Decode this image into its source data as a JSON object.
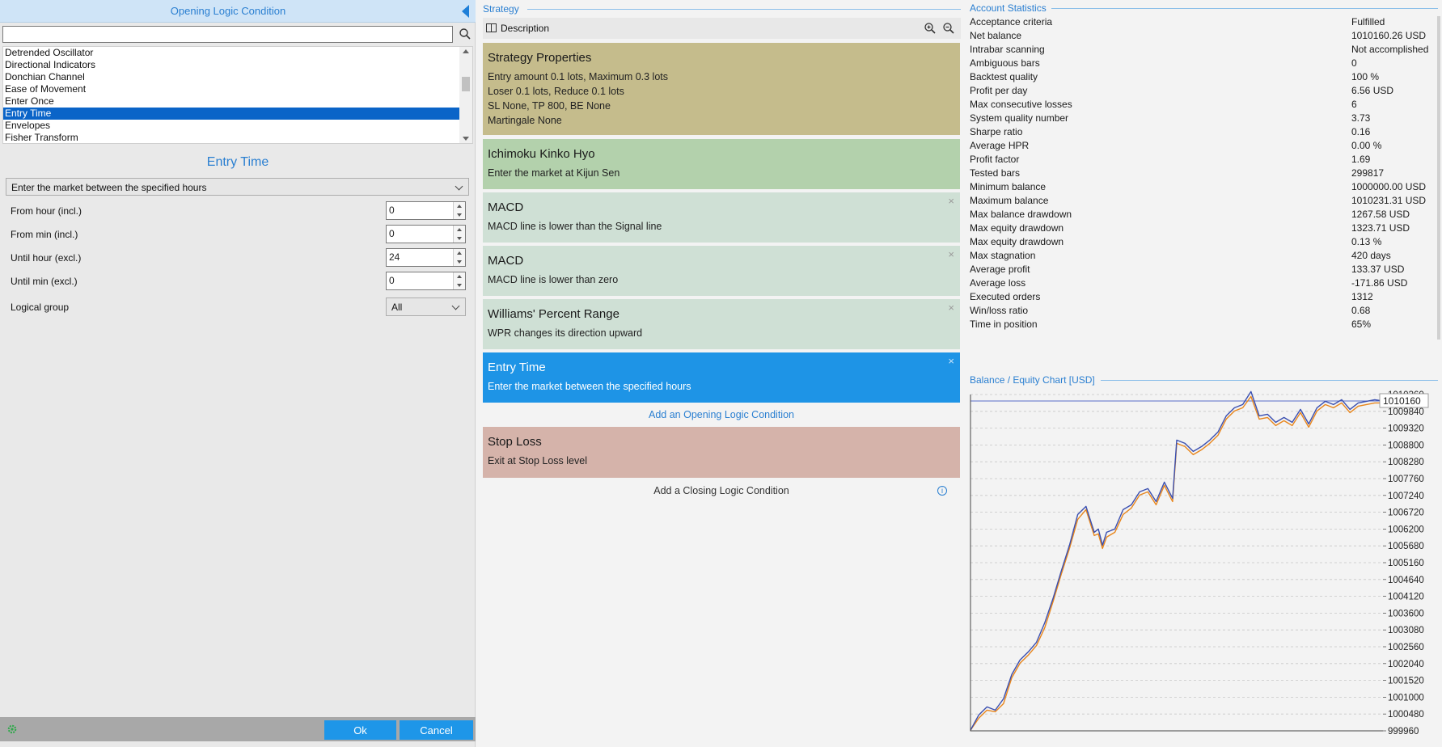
{
  "left_panel": {
    "title": "Opening Logic Condition",
    "search": {
      "value": "",
      "placeholder": ""
    },
    "indicator_list": [
      "Detrended Oscillator",
      "Directional Indicators",
      "Donchian Channel",
      "Ease of Movement",
      "Enter Once",
      "Entry Time",
      "Envelopes",
      "Fisher Transform"
    ],
    "selected_index": 5,
    "indicator_title": "Entry Time",
    "logic_select": "Enter the market between the specified hours",
    "params": [
      {
        "label": "From hour (incl.)",
        "value": "0"
      },
      {
        "label": "From min (incl.)",
        "value": "0"
      },
      {
        "label": "Until hour (excl.)",
        "value": "24"
      },
      {
        "label": "Until min (excl.)",
        "value": "0"
      }
    ],
    "logical_group": {
      "label": "Logical group",
      "value": "All"
    },
    "ok_label": "Ok",
    "cancel_label": "Cancel"
  },
  "strategy": {
    "section_title": "Strategy",
    "description_label": "Description",
    "properties": {
      "name": "Strategy Properties",
      "lines": [
        "Entry amount 0.1 lots, Maximum 0.3 lots",
        "Loser 0.1 lots, Reduce 0.1 lots",
        "SL None,  TP 800,  BE None",
        "Martingale None"
      ]
    },
    "slots": [
      {
        "name": "Ichimoku Kinko Hyo",
        "desc": "Enter the market at Kijun Sen",
        "color": "#b3d1ac"
      },
      {
        "name": "MACD",
        "desc": "MACD line is lower than the Signal line",
        "color": "#cfe0d5"
      },
      {
        "name": "MACD",
        "desc": "MACD line is lower than zero",
        "color": "#cfe0d5"
      },
      {
        "name": "Williams' Percent Range",
        "desc": "WPR changes its direction upward",
        "color": "#cfe0d5"
      },
      {
        "name": "Entry Time",
        "desc": "Enter the market between the specified hours",
        "color": "#1e94e6"
      }
    ],
    "add_opening_label": "Add an Opening Logic Condition",
    "closing_slot": {
      "name": "Stop Loss",
      "desc": "Exit at Stop Loss level",
      "color": "#d5b3aa"
    },
    "add_closing_label": "Add a Closing Logic Condition",
    "close_glyph": "×",
    "info_glyph": "i"
  },
  "account_statistics": {
    "section_title": "Account Statistics",
    "rows": [
      {
        "k": "Acceptance criteria",
        "v": "Fulfilled"
      },
      {
        "k": "Net balance",
        "v": "1010160.26 USD"
      },
      {
        "k": "Intrabar scanning",
        "v": "Not accomplished"
      },
      {
        "k": "Ambiguous bars",
        "v": "0"
      },
      {
        "k": "Backtest quality",
        "v": "100 %"
      },
      {
        "k": "Profit per day",
        "v": "6.56 USD"
      },
      {
        "k": "Max consecutive losses",
        "v": "6"
      },
      {
        "k": "System quality number",
        "v": "3.73"
      },
      {
        "k": "Sharpe ratio",
        "v": "0.16"
      },
      {
        "k": "Average HPR",
        "v": "0.00 %"
      },
      {
        "k": "Profit factor",
        "v": "1.69"
      },
      {
        "k": "Tested bars",
        "v": "299817"
      },
      {
        "k": "Minimum balance",
        "v": "1000000.00 USD"
      },
      {
        "k": "Maximum balance",
        "v": "1010231.31 USD"
      },
      {
        "k": "Max balance drawdown",
        "v": "1267.58 USD"
      },
      {
        "k": "Max equity drawdown",
        "v": "1323.71 USD"
      },
      {
        "k": "Max equity drawdown",
        "v": "0.13 %"
      },
      {
        "k": "Max stagnation",
        "v": "420 days"
      },
      {
        "k": "Average profit",
        "v": "133.37 USD"
      },
      {
        "k": "Average loss",
        "v": "-171.86 USD"
      },
      {
        "k": "Executed orders",
        "v": "1312"
      },
      {
        "k": "Win/loss ratio",
        "v": "0.68"
      },
      {
        "k": "Time in position",
        "v": "65%"
      }
    ]
  },
  "chart_data": {
    "type": "line",
    "title": "Balance / Equity Chart [USD]",
    "xlabel": "",
    "ylabel": "",
    "ylim": [
      999960,
      1010360
    ],
    "yticks": [
      "1010360",
      "1009840",
      "1009320",
      "1008800",
      "1008280",
      "1007760",
      "1007240",
      "1006720",
      "1006200",
      "1005680",
      "1005160",
      "1004640",
      "1004120",
      "1003600",
      "1003080",
      "1002560",
      "1002040",
      "1001520",
      "1001000",
      "1000480",
      "999960"
    ],
    "current_value_label": "1010160",
    "current_value": 1010160,
    "x": [
      0,
      0.02,
      0.04,
      0.06,
      0.08,
      0.1,
      0.12,
      0.14,
      0.16,
      0.18,
      0.2,
      0.22,
      0.24,
      0.26,
      0.28,
      0.3,
      0.31,
      0.32,
      0.33,
      0.35,
      0.37,
      0.39,
      0.41,
      0.43,
      0.45,
      0.47,
      0.49,
      0.5,
      0.52,
      0.54,
      0.56,
      0.58,
      0.6,
      0.62,
      0.64,
      0.66,
      0.68,
      0.7,
      0.72,
      0.74,
      0.76,
      0.78,
      0.8,
      0.82,
      0.84,
      0.86,
      0.88,
      0.9,
      0.92,
      0.94,
      0.96,
      0.98,
      1.0
    ],
    "series": [
      {
        "color": "#3a4fb0",
        "values": [
          999980,
          1000450,
          1000700,
          1000600,
          1000950,
          1001700,
          1002150,
          1002400,
          1002700,
          1003300,
          1004050,
          1004900,
          1005700,
          1006650,
          1006900,
          1006100,
          1006200,
          1005700,
          1006100,
          1006200,
          1006800,
          1006950,
          1007350,
          1007450,
          1007050,
          1007650,
          1007150,
          1008950,
          1008850,
          1008600,
          1008750,
          1008950,
          1009200,
          1009700,
          1009950,
          1010050,
          1010450,
          1009700,
          1009750,
          1009500,
          1009650,
          1009500,
          1009900,
          1009450,
          1009950,
          1010150,
          1010050,
          1010200,
          1009900,
          1010100,
          1010150,
          1010200,
          1010160
        ]
      },
      {
        "color": "#e8861c",
        "values": [
          999980,
          1000350,
          1000600,
          1000550,
          1000800,
          1001600,
          1002050,
          1002300,
          1002600,
          1003150,
          1003950,
          1004800,
          1005600,
          1006500,
          1006800,
          1006000,
          1006050,
          1005600,
          1005950,
          1006100,
          1006650,
          1006850,
          1007250,
          1007350,
          1006950,
          1007550,
          1007050,
          1008850,
          1008750,
          1008500,
          1008650,
          1008850,
          1009100,
          1009600,
          1009850,
          1009950,
          1010300,
          1009600,
          1009650,
          1009400,
          1009550,
          1009400,
          1009800,
          1009350,
          1009850,
          1010050,
          1009950,
          1010100,
          1009800,
          1010000,
          1010050,
          1010100,
          1010100
        ]
      }
    ],
    "grid": true,
    "colors": {
      "balance": "#3a4fb0",
      "equity": "#e8861c"
    }
  },
  "colors": {
    "accent": "#2a7fd1",
    "selected_row": "#0a64c8",
    "buttons": "#1e96e8"
  }
}
